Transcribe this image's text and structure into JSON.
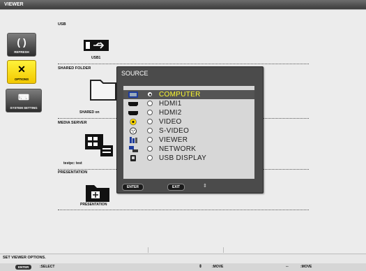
{
  "window": {
    "title": "VIEWER"
  },
  "sidebar": {
    "refresh_label": "REFRESH",
    "options_label": "OPTIONS",
    "system_label": "SYSTEM SETTING"
  },
  "sections": {
    "usb": {
      "label": "USB",
      "device": "USB1"
    },
    "shared": {
      "label": "SHARED FOLDER",
      "device": "SHARED on"
    },
    "media": {
      "label": "MEDIA SERVER",
      "device": "testpc: test"
    },
    "presentation": {
      "label": "PRESENTATION",
      "device": "PRESENTATION"
    }
  },
  "dialog": {
    "title": "SOURCE",
    "items": [
      {
        "label": "COMPUTER",
        "icon": "computer-port-icon",
        "selected": true
      },
      {
        "label": "HDMI1",
        "icon": "hdmi-port-icon",
        "selected": false
      },
      {
        "label": "HDMI2",
        "icon": "hdmi-port-icon",
        "selected": false
      },
      {
        "label": "VIDEO",
        "icon": "video-port-icon",
        "selected": false
      },
      {
        "label": "S-VIDEO",
        "icon": "s-video-port-icon",
        "selected": false
      },
      {
        "label": "VIEWER",
        "icon": "viewer-icon",
        "selected": false
      },
      {
        "label": "NETWORK",
        "icon": "network-icon",
        "selected": false
      },
      {
        "label": "USB DISPLAY",
        "icon": "usb-display-icon",
        "selected": false
      }
    ],
    "enter_key": "ENTER",
    "exit_key": "EXIT",
    "selected_color": "#fffc2e"
  },
  "status": {
    "message": "SET VIEWER OPTIONS.",
    "enter_key": "ENTER",
    "select_text": ":SELECT",
    "move1_text": ":MOVE",
    "move2_text": ":MOVE"
  }
}
